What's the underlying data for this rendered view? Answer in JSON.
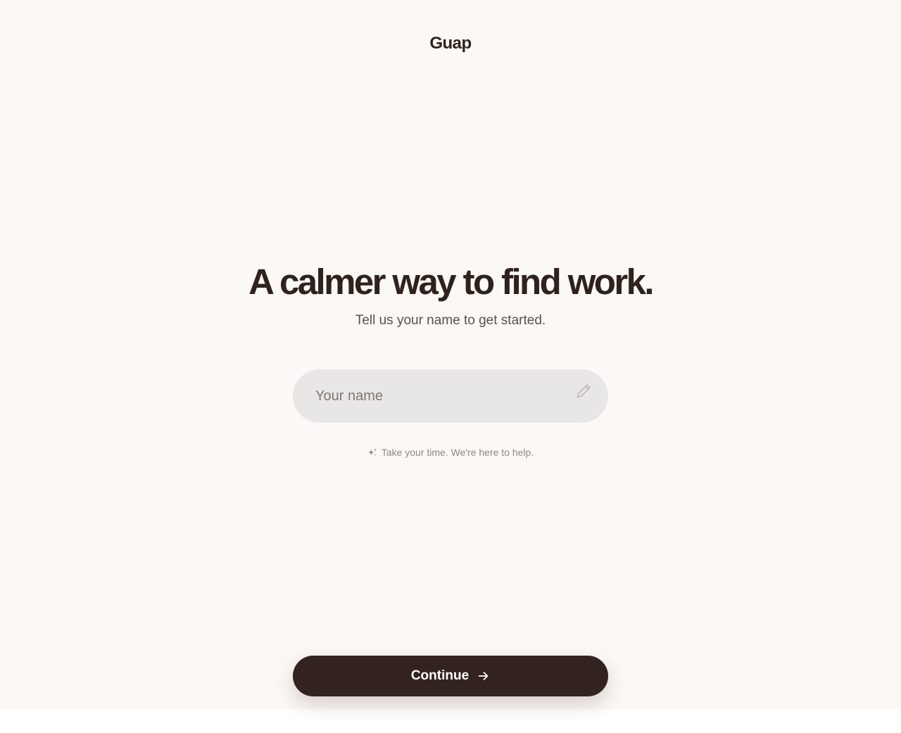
{
  "brand": {
    "name": "Guap"
  },
  "hero": {
    "headline": "A calmer way to find work.",
    "subheadline": "Tell us your name to get started."
  },
  "name_field": {
    "placeholder": "Your name",
    "value": "",
    "icon": "pencil-icon"
  },
  "hint": {
    "icon": "sparkle-icon",
    "text": "Take your time. We're here to help."
  },
  "continue_button": {
    "label": "Continue",
    "icon": "arrow-right-icon"
  },
  "colors": {
    "background": "#fbf8f5",
    "text_dark": "#2f221d",
    "field_bg": "#e9e7e5",
    "button_bg": "#33231e",
    "button_text": "#ffffff"
  }
}
